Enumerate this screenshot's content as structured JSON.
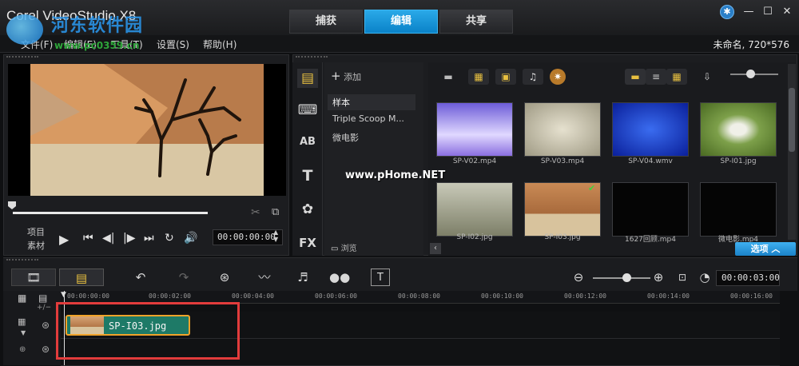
{
  "window": {
    "title": "Corel VideoStudio X8",
    "tabs": [
      {
        "label": "捕获",
        "active": false
      },
      {
        "label": "编辑",
        "active": true
      },
      {
        "label": "共享",
        "active": false
      }
    ],
    "controls": {
      "minimize": "—",
      "maximize": "☐",
      "close": "✕"
    }
  },
  "menu": {
    "items": [
      "文件(F)",
      "编辑(E)",
      "工具(T)",
      "设置(S)",
      "帮助(H)"
    ],
    "project_info": "未命名, 720*576"
  },
  "watermark": {
    "line1": "河东软件园",
    "line2": "www.pc0359.cn",
    "center": "www.pHome.NET"
  },
  "player": {
    "project_label": "项目",
    "clip_label": "素材",
    "timecode": "00:00:00:00"
  },
  "library": {
    "add_label": "添加",
    "browse_label": "浏览",
    "folders": [
      {
        "label": "样本",
        "selected": true
      },
      {
        "label": "Triple Scoop M...",
        "selected": false
      },
      {
        "label": "微电影",
        "selected": false
      }
    ],
    "options_label": "选项",
    "tool_labels": {
      "title": "T",
      "fx": "FX",
      "ab": "AB"
    },
    "items": [
      {
        "label": "SP-V02.mp4",
        "kind": "video",
        "color": "#8a6ee0"
      },
      {
        "label": "SP-V03.mp4",
        "kind": "video",
        "color": "#c9c4b0"
      },
      {
        "label": "SP-V04.wmv",
        "kind": "video",
        "color": "#1a3fd0"
      },
      {
        "label": "SP-I01.jpg",
        "kind": "image",
        "color": "#7da04a"
      },
      {
        "label": "SP-I02.jpg",
        "kind": "image",
        "color": "#8c8f7a"
      },
      {
        "label": "SP-I03.jpg",
        "kind": "image",
        "color": "#b07a4a",
        "checked": true
      },
      {
        "label": "1627回顾.mp4",
        "kind": "video",
        "color": "#050505"
      },
      {
        "label": "微电影.mp4",
        "kind": "video",
        "color": "#050505"
      }
    ]
  },
  "timeline": {
    "timecode": "00:00:03:00",
    "ruler": [
      "00:00:00:00",
      "00:00:02:00",
      "00:00:04:00",
      "00:00:06:00",
      "00:00:08:00",
      "00:00:10:00",
      "00:00:12:00",
      "00:00:14:00",
      "00:00:16:00"
    ],
    "clip_name": "SP-I03.jpg"
  }
}
